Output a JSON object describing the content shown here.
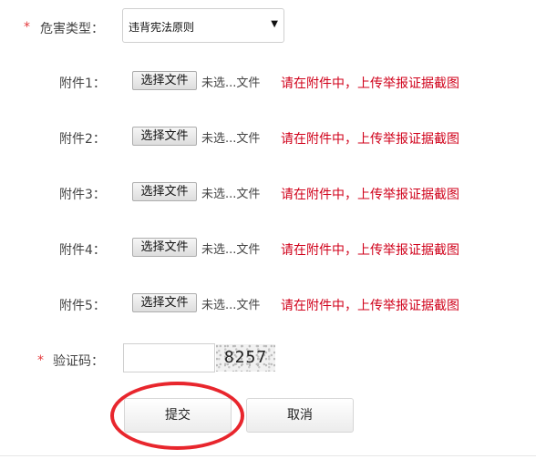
{
  "form": {
    "required_mark": "*",
    "harm_type": {
      "label": "危害类型：",
      "selected": "违背宪法原则"
    },
    "file_button_label": "选择文件",
    "file_status": "未选...文件",
    "attachments": [
      {
        "label": "附件1：",
        "hint": "请在附件中，上传举报证据截图"
      },
      {
        "label": "附件2：",
        "hint": "请在附件中，上传举报证据截图"
      },
      {
        "label": "附件3：",
        "hint": "请在附件中，上传举报证据截图"
      },
      {
        "label": "附件4：",
        "hint": "请在附件中，上传举报证据截图"
      },
      {
        "label": "附件5：",
        "hint": "请在附件中，上传举报证据截图"
      }
    ],
    "captcha": {
      "label": "验证码：",
      "value": "",
      "image_text": "8257"
    },
    "buttons": {
      "submit": "提交",
      "cancel": "取消"
    }
  },
  "colors": {
    "required": "#e4393c",
    "hint": "#d0021b",
    "annotation_circle": "#e8262d"
  }
}
